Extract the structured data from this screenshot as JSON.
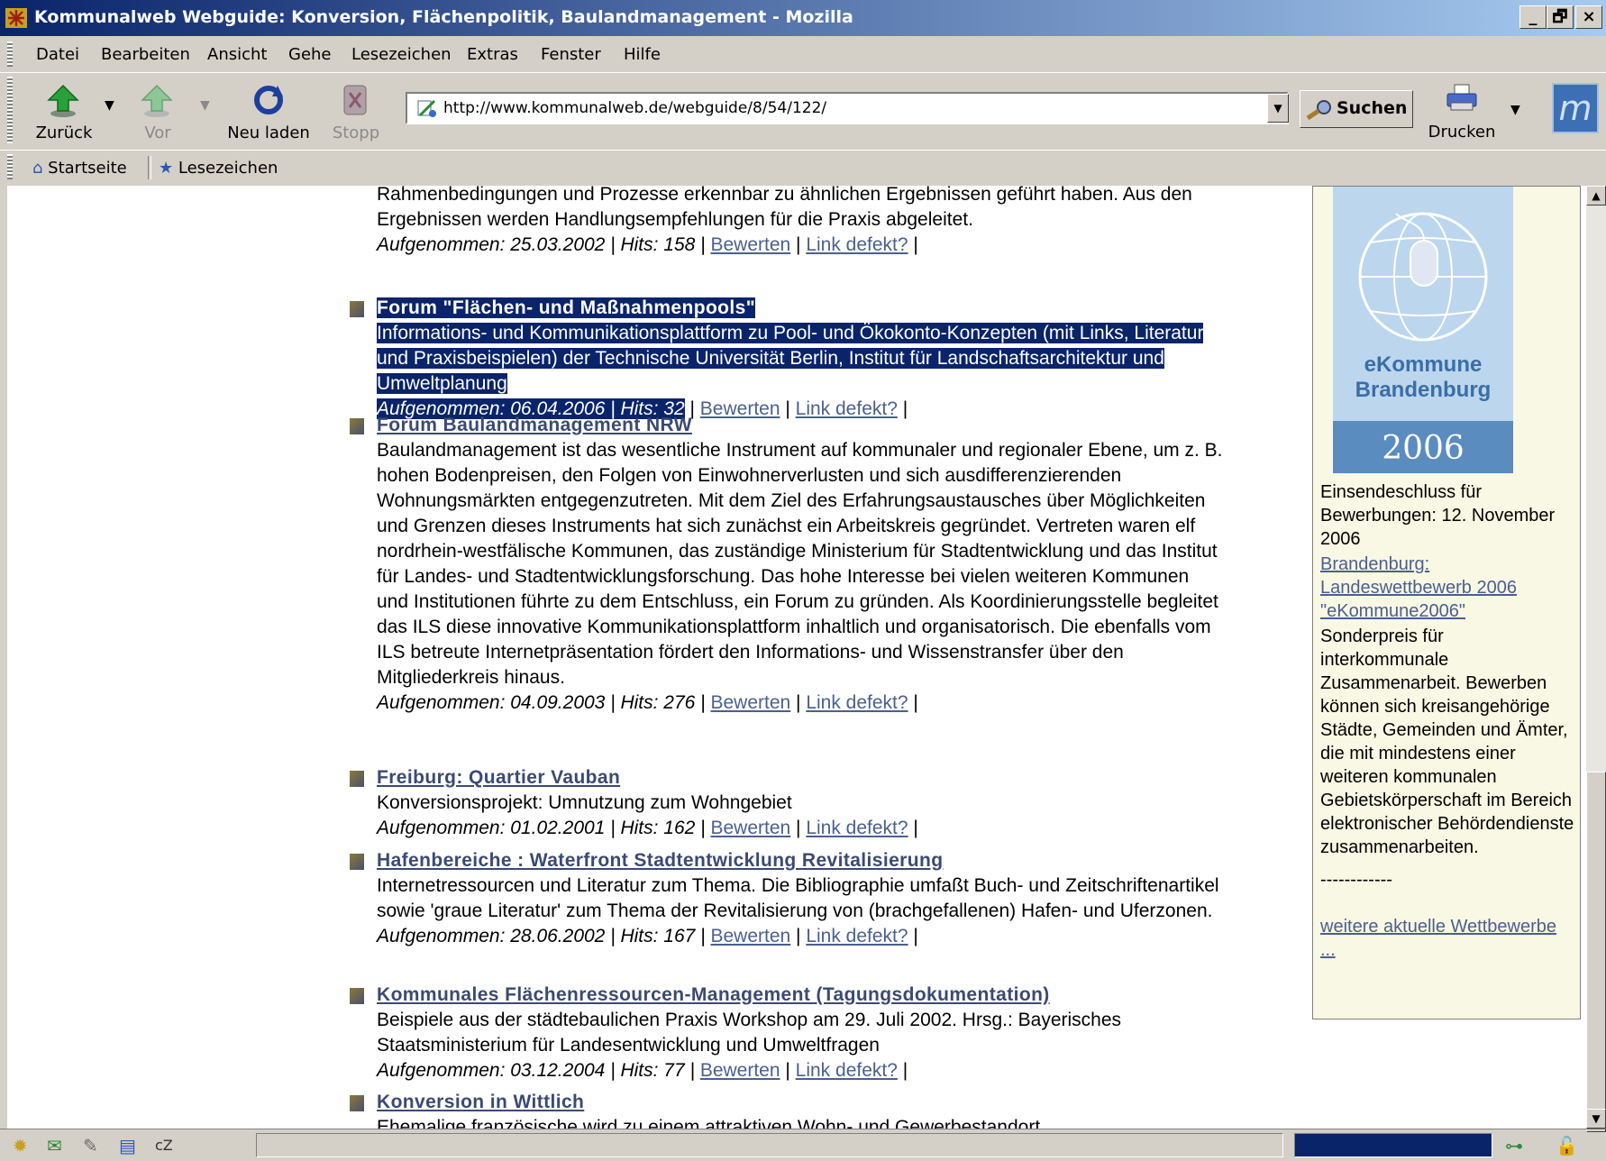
{
  "window": {
    "title": "Kommunalweb Webguide: Konversion, Flächenpolitik, Baulandmanagement - Mozilla",
    "controls": [
      "_",
      "🗗",
      "×"
    ]
  },
  "menu": [
    "Datei",
    "Bearbeiten",
    "Ansicht",
    "Gehe",
    "Lesezeichen",
    "Extras",
    "Fenster",
    "Hilfe"
  ],
  "nav": {
    "back": "Zurück",
    "forward": "Vor",
    "reload": "Neu laden",
    "stop": "Stopp",
    "url": "http://www.kommunalweb.de/webguide/8/54/122/",
    "search": "Suchen",
    "print": "Drucken"
  },
  "bookmarks": {
    "home": "Startseite",
    "bookmarks": "Lesezeichen"
  },
  "content": {
    "top_fragment": {
      "text": "Rahmenbedingungen und Prozesse erkennbar zu ähnlichen Ergebnissen geführt haben. Aus den Ergebnissen werden Handlungsempfehlungen für die Praxis abgeleitet.",
      "meta": "Aufgenommen: 25.03.2002 | Hits: 158 |",
      "rate": "Bewerten",
      "defect": "Link defekt?"
    },
    "entries": [
      {
        "title": "Forum \"Flächen- und Maßnahmenpools\"",
        "desc": "Informations- und Kommunikationsplattform zu Pool- und Ökokonto-Konzepten (mit Links, Literatur und Praxisbeispielen) der Technische Universität Berlin, Institut für Landschaftsarchitektur und Umweltplanung",
        "meta": "Aufgenommen: 06.04.2006 | Hits: 32",
        "rate": "Bewerten",
        "defect": "Link defekt?"
      },
      {
        "title": "Forum Baulandmanagement NRW",
        "desc": "Baulandmanagement ist das wesentliche Instrument auf kommunaler und regionaler Ebene, um z. B. hohen Bodenpreisen, den Folgen von Einwohnerverlusten und sich ausdifferenzierenden Wohnungsmärkten entgegenzutreten. Mit dem Ziel des Erfahrungsaustausches über Möglichkeiten und Grenzen dieses Instruments hat sich zunächst ein Arbeitskreis gegründet. Vertreten waren elf nordrhein-westfälische Kommunen, das zuständige Ministerium für Stadtentwicklung und das Institut für Landes- und Stadtentwicklungsforschung. Das hohe Interesse bei vielen weiteren Kommunen und Institutionen führte zu dem Entschluss, ein Forum zu gründen. Als Koordinierungsstelle begleitet das ILS diese innovative Kommunikationsplattform inhaltlich und organisatorisch. Die ebenfalls vom ILS betreute Internetpräsentation fördert den Informations- und Wissenstransfer über den Mitgliederkreis hinaus.",
        "meta": "Aufgenommen: 04.09.2003 | Hits: 276 |",
        "rate": "Bewerten",
        "defect": "Link defekt?"
      },
      {
        "title": "Freiburg: Quartier Vauban",
        "desc": "Konversionsprojekt: Umnutzung zum Wohngebiet",
        "meta": "Aufgenommen: 01.02.2001 | Hits: 162 |",
        "rate": "Bewerten",
        "defect": "Link defekt?"
      },
      {
        "title": "Hafenbereiche : Waterfront Stadtentwicklung Revitalisierung",
        "desc": "Internetressourcen und Literatur zum Thema. Die Bibliographie umfaßt Buch- und Zeitschriftenartikel sowie 'graue Literatur' zum Thema der Revitalisierung von (brachgefallenen) Hafen- und Uferzonen.",
        "meta": "Aufgenommen: 28.06.2002 | Hits: 167 |",
        "rate": "Bewerten",
        "defect": "Link defekt?"
      },
      {
        "title": "Kommunales Flächenressourcen-Management (Tagungsdokumentation)",
        "desc": "Beispiele aus der städtebaulichen Praxis Workshop am 29. Juli 2002. Hrsg.: Bayerisches Staatsministerium für Landesentwicklung und Umweltfragen",
        "meta": "Aufgenommen: 03.12.2004 | Hits: 77 |",
        "rate": "Bewerten",
        "defect": "Link defekt?"
      },
      {
        "title": "Konversion in Wittlich",
        "desc": "Ehemalige französische wird zu einem attraktiven Wohn- und Gewerbestandort"
      }
    ]
  },
  "sidebar": {
    "badge_line1": "eKommune",
    "badge_line2": "Brandenburg",
    "badge_year": "2006",
    "deadline": "Einsendeschluss für Bewerbungen: 12. November 2006",
    "link1": "Brandenburg: Landeswettbewerb 2006 \"eKommune2006\"",
    "body": "Sonderpreis für interkommunale Zusammenarbeit. Bewerben können sich kreisangehörige Städte, Gemeinden und Ämter, die mit mindestens einer weiteren kommunalen Gebietskörperschaft im Bereich elektronischer Behördendienste zusammenarbeiten.",
    "divider": "------------",
    "more": "weitere aktuelle Wettbewerbe ..."
  },
  "colors": {
    "title_gradient_start": "#0a246a",
    "selection": "#0a246a",
    "link": "#4b5f8f",
    "sidebar_bg": "#f8f8e4"
  }
}
